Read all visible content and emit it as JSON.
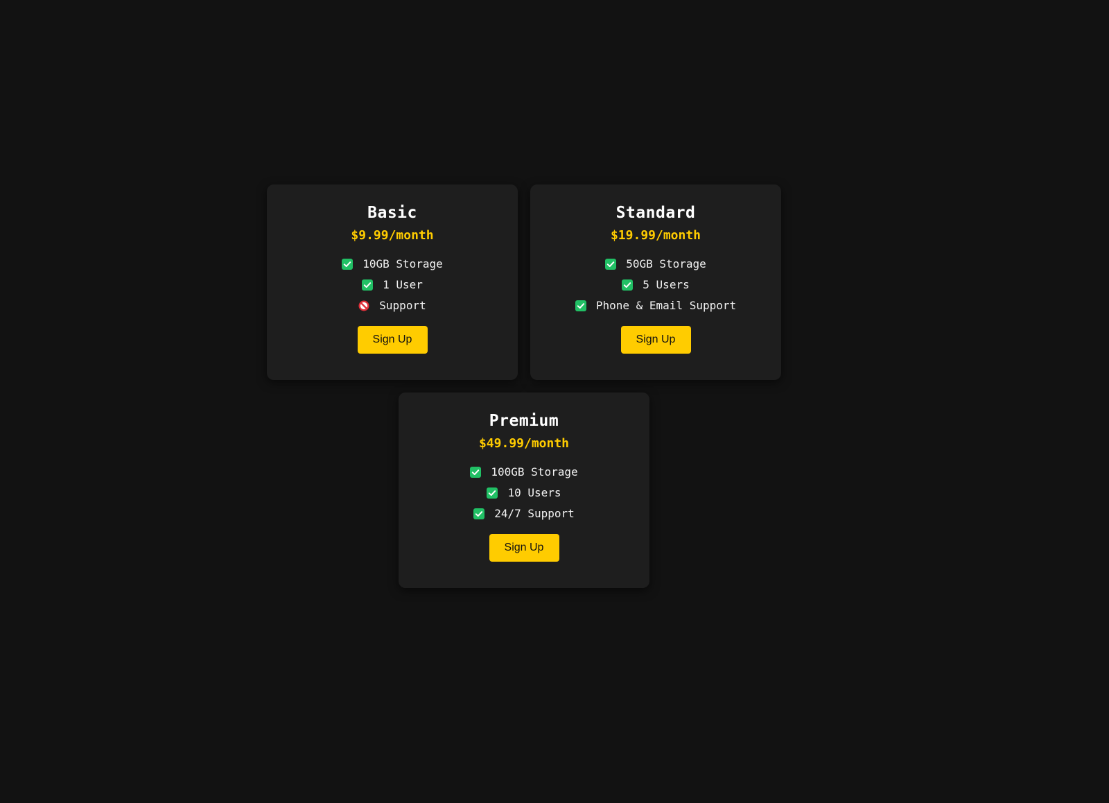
{
  "plans": [
    {
      "name": "Basic",
      "price": "$9.99/month",
      "features": [
        {
          "text": "10GB Storage",
          "icon": "check-icon"
        },
        {
          "text": "1 User",
          "icon": "check-icon"
        },
        {
          "text": "Support",
          "icon": "prohibited-icon"
        }
      ],
      "cta": "Sign Up"
    },
    {
      "name": "Standard",
      "price": "$19.99/month",
      "features": [
        {
          "text": "50GB Storage",
          "icon": "check-icon"
        },
        {
          "text": "5 Users",
          "icon": "check-icon"
        },
        {
          "text": "Phone & Email Support",
          "icon": "check-icon"
        }
      ],
      "cta": "Sign Up"
    },
    {
      "name": "Premium",
      "price": "$49.99/month",
      "features": [
        {
          "text": "100GB Storage",
          "icon": "check-icon"
        },
        {
          "text": "10 Users",
          "icon": "check-icon"
        },
        {
          "text": "24/7 Support",
          "icon": "check-icon"
        }
      ],
      "cta": "Sign Up"
    }
  ],
  "colors": {
    "background": "#121212",
    "card": "#1e1e1e",
    "accent": "#ffcc00",
    "check": "#21c065",
    "prohibited": "#e0303a"
  }
}
